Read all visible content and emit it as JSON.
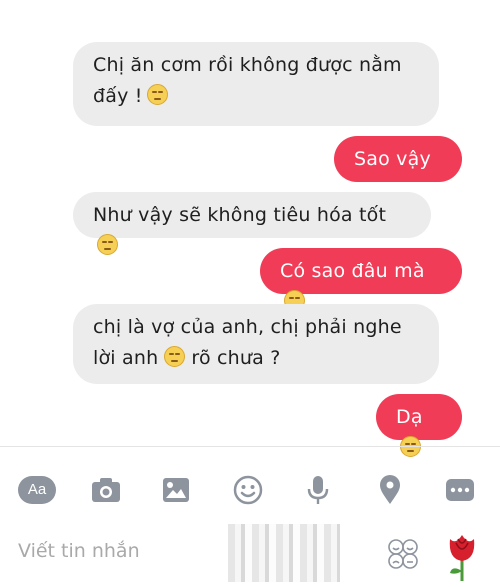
{
  "messages": [
    {
      "side": "received",
      "line1": "Chị ăn cơm rồi không được nằm",
      "line2": "đấy !",
      "emoji": "pensive-face"
    },
    {
      "side": "sent",
      "text": "Sao vậy ?"
    },
    {
      "side": "received",
      "text": "Như vậy sẽ không tiêu hóa tốt",
      "emoji": "pensive-face"
    },
    {
      "side": "sent",
      "text": "Có sao đâu mà",
      "emoji": "relieved-face"
    },
    {
      "side": "received",
      "line1": "chị là vợ của anh, chị phải nghe",
      "line2a": "lời anh",
      "line2b": "rõ chưa ?",
      "emoji": "unamused-face"
    },
    {
      "side": "sent",
      "text": "Dạ",
      "emoji": "relieved-face"
    }
  ],
  "toolbar": {
    "aa_label": "Aa",
    "icons": [
      "text-style-icon",
      "camera-icon",
      "gallery-icon",
      "emoji-icon",
      "microphone-icon",
      "location-icon",
      "more-icon"
    ]
  },
  "composer": {
    "placeholder": "Viết tin nhắn",
    "icons": [
      "sticker-icon",
      "rose-icon"
    ]
  },
  "colors": {
    "sent_bubble": "#f03c57",
    "received_bubble": "#ececec",
    "icon_gray": "#8d949e"
  }
}
